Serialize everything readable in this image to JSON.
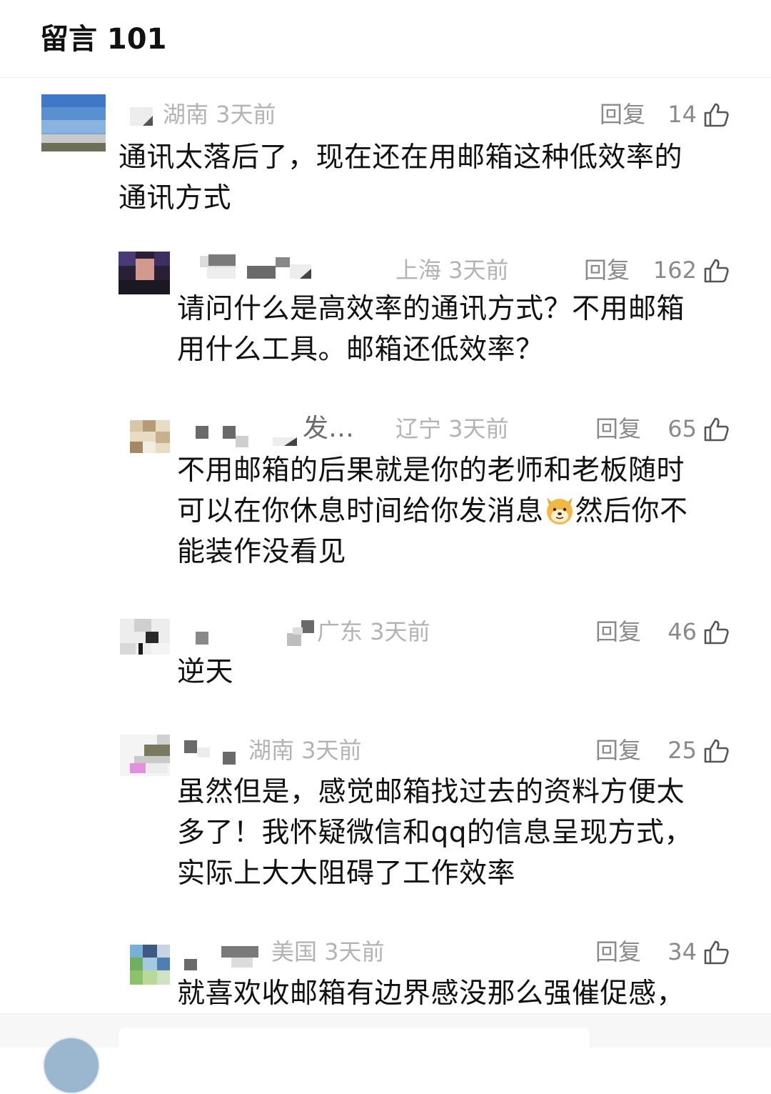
{
  "header": {
    "title": "留言 101"
  },
  "comments": [
    {
      "location_time": "湖南 3天前",
      "reply": "回复",
      "likes": "14",
      "text_lines": [
        "通讯太落后了，现在还在用邮箱这种低效率的",
        "通讯方式"
      ]
    },
    {
      "location_time": "上海 3天前",
      "reply": "回复",
      "likes": "162",
      "text_lines": [
        "请问什么是高效率的通讯方式？不用邮箱",
        "用什么工具。邮箱还低效率？"
      ]
    },
    {
      "username_visible": "发…",
      "location_time": "辽宁 3天前",
      "reply": "回复",
      "likes": "65",
      "text_lines": [
        "不用邮箱的后果就是你的老师和老板随时",
        "可以在你休息时间给你发消息",
        "然后你不",
        "能装作没看见"
      ]
    },
    {
      "location_time": "广东 3天前",
      "reply": "回复",
      "likes": "46",
      "text_lines": [
        "逆天"
      ]
    },
    {
      "location_time": "湖南 3天前",
      "reply": "回复",
      "likes": "25",
      "text_lines": [
        "虽然但是，感觉邮箱找过去的资料方便太",
        "多了！我怀疑微信和qq的信息呈现方式，",
        "实际上大大阻碍了工作效率"
      ]
    },
    {
      "location_time": "美国 3天前",
      "reply": "回复",
      "likes": "34",
      "text_lines": [
        "就喜欢收邮箱有边界感没那么强催促感，"
      ]
    }
  ],
  "icons": {
    "like": "thumbs-up-icon",
    "emoji": "doge-emoji-icon"
  },
  "colors": {
    "meta_gray": "#b3b3b3",
    "action_gray": "#8a8a8a",
    "text": "#111111"
  }
}
